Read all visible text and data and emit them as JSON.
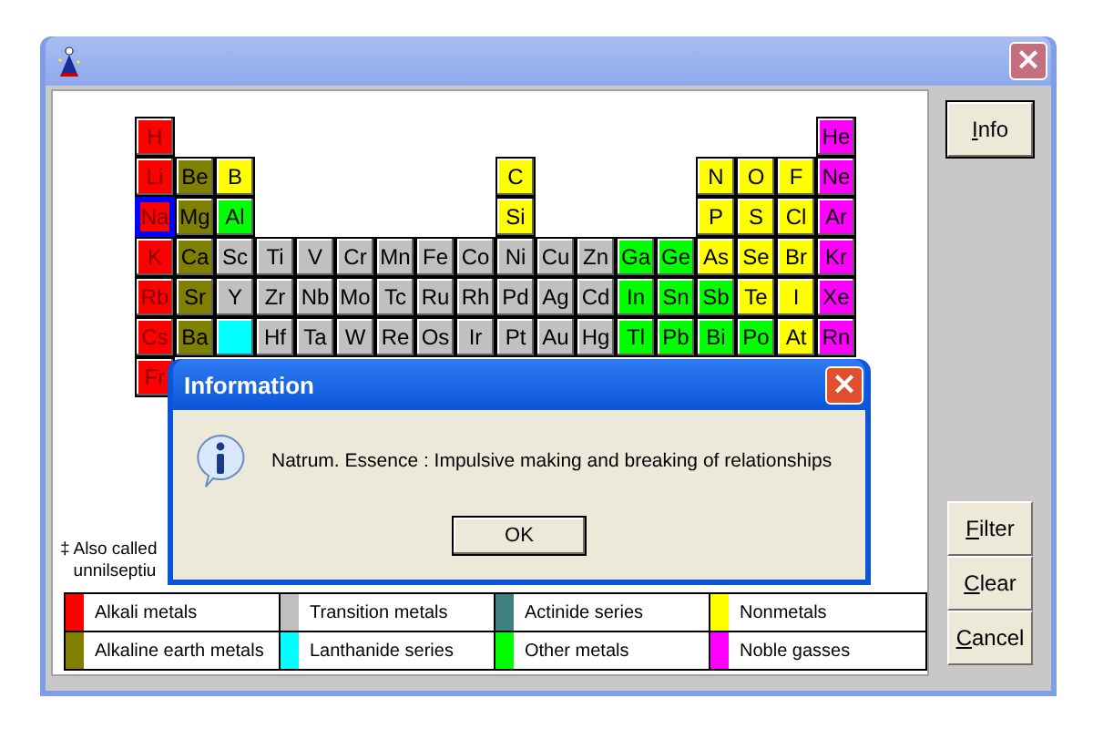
{
  "window": {
    "close": "×"
  },
  "table": {
    "rows": [
      {
        "cells": [
          {
            "symbol": "H",
            "kind": "alkali",
            "selected": false
          },
          {
            "kind": "empty"
          },
          {
            "kind": "empty"
          },
          {
            "kind": "empty"
          },
          {
            "kind": "empty"
          },
          {
            "kind": "empty"
          },
          {
            "kind": "empty"
          },
          {
            "kind": "empty"
          },
          {
            "kind": "empty"
          },
          {
            "kind": "empty"
          },
          {
            "kind": "empty"
          },
          {
            "kind": "empty"
          },
          {
            "kind": "empty"
          },
          {
            "kind": "empty"
          },
          {
            "kind": "empty"
          },
          {
            "kind": "empty"
          },
          {
            "kind": "empty"
          },
          {
            "symbol": "He",
            "kind": "noble",
            "selected": false
          }
        ]
      },
      {
        "cells": [
          {
            "symbol": "Li",
            "kind": "alkali",
            "selected": false
          },
          {
            "symbol": "Be",
            "kind": "alkaline",
            "selected": false
          },
          {
            "symbol": "B",
            "kind": "nonmetal",
            "selected": false
          },
          {
            "kind": "empty"
          },
          {
            "kind": "empty"
          },
          {
            "kind": "empty"
          },
          {
            "kind": "empty"
          },
          {
            "kind": "empty"
          },
          {
            "kind": "empty"
          },
          {
            "symbol": "C",
            "kind": "nonmetal",
            "selected": false
          },
          {
            "kind": "empty"
          },
          {
            "kind": "empty"
          },
          {
            "kind": "empty"
          },
          {
            "kind": "empty"
          },
          {
            "symbol": "N",
            "kind": "nonmetal",
            "selected": false
          },
          {
            "symbol": "O",
            "kind": "nonmetal",
            "selected": false
          },
          {
            "symbol": "F",
            "kind": "nonmetal",
            "selected": false
          },
          {
            "symbol": "Ne",
            "kind": "noble",
            "selected": false
          }
        ]
      },
      {
        "cells": [
          {
            "symbol": "Na",
            "kind": "alkali",
            "selected": true
          },
          {
            "symbol": "Mg",
            "kind": "alkaline",
            "selected": false
          },
          {
            "symbol": "Al",
            "kind": "other",
            "selected": false
          },
          {
            "kind": "empty"
          },
          {
            "kind": "empty"
          },
          {
            "kind": "empty"
          },
          {
            "kind": "empty"
          },
          {
            "kind": "empty"
          },
          {
            "kind": "empty"
          },
          {
            "symbol": "Si",
            "kind": "nonmetal",
            "selected": false
          },
          {
            "kind": "empty"
          },
          {
            "kind": "empty"
          },
          {
            "kind": "empty"
          },
          {
            "kind": "empty"
          },
          {
            "symbol": "P",
            "kind": "nonmetal",
            "selected": false
          },
          {
            "symbol": "S",
            "kind": "nonmetal",
            "selected": false
          },
          {
            "symbol": "Cl",
            "kind": "nonmetal",
            "selected": false
          },
          {
            "symbol": "Ar",
            "kind": "noble",
            "selected": false
          }
        ]
      },
      {
        "cells": [
          {
            "symbol": "K",
            "kind": "alkali",
            "selected": false
          },
          {
            "symbol": "Ca",
            "kind": "alkaline",
            "selected": false
          },
          {
            "symbol": "Sc",
            "kind": "transition",
            "selected": false
          },
          {
            "symbol": "Ti",
            "kind": "transition",
            "selected": false
          },
          {
            "symbol": "V",
            "kind": "transition",
            "selected": false
          },
          {
            "symbol": "Cr",
            "kind": "transition",
            "selected": false
          },
          {
            "symbol": "Mn",
            "kind": "transition",
            "selected": false
          },
          {
            "symbol": "Fe",
            "kind": "transition",
            "selected": false
          },
          {
            "symbol": "Co",
            "kind": "transition",
            "selected": false
          },
          {
            "symbol": "Ni",
            "kind": "transition",
            "selected": false
          },
          {
            "symbol": "Cu",
            "kind": "transition",
            "selected": false
          },
          {
            "symbol": "Zn",
            "kind": "transition",
            "selected": false
          },
          {
            "symbol": "Ga",
            "kind": "other",
            "selected": false
          },
          {
            "symbol": "Ge",
            "kind": "other",
            "selected": false
          },
          {
            "symbol": "As",
            "kind": "nonmetal",
            "selected": false
          },
          {
            "symbol": "Se",
            "kind": "nonmetal",
            "selected": false
          },
          {
            "symbol": "Br",
            "kind": "nonmetal",
            "selected": false
          },
          {
            "symbol": "Kr",
            "kind": "noble",
            "selected": false
          }
        ]
      },
      {
        "cells": [
          {
            "symbol": "Rb",
            "kind": "alkali",
            "selected": false
          },
          {
            "symbol": "Sr",
            "kind": "alkaline",
            "selected": false
          },
          {
            "symbol": "Y",
            "kind": "transition",
            "selected": false
          },
          {
            "symbol": "Zr",
            "kind": "transition",
            "selected": false
          },
          {
            "symbol": "Nb",
            "kind": "transition",
            "selected": false
          },
          {
            "symbol": "Mo",
            "kind": "transition",
            "selected": false
          },
          {
            "symbol": "Tc",
            "kind": "transition",
            "selected": false
          },
          {
            "symbol": "Ru",
            "kind": "transition",
            "selected": false
          },
          {
            "symbol": "Rh",
            "kind": "transition",
            "selected": false
          },
          {
            "symbol": "Pd",
            "kind": "transition",
            "selected": false
          },
          {
            "symbol": "Ag",
            "kind": "transition",
            "selected": false
          },
          {
            "symbol": "Cd",
            "kind": "transition",
            "selected": false
          },
          {
            "symbol": "In",
            "kind": "other",
            "selected": false
          },
          {
            "symbol": "Sn",
            "kind": "other",
            "selected": false
          },
          {
            "symbol": "Sb",
            "kind": "other",
            "selected": false
          },
          {
            "symbol": "Te",
            "kind": "nonmetal",
            "selected": false
          },
          {
            "symbol": "I",
            "kind": "nonmetal",
            "selected": false
          },
          {
            "symbol": "Xe",
            "kind": "noble",
            "selected": false
          }
        ]
      },
      {
        "cells": [
          {
            "symbol": "Cs",
            "kind": "alkali",
            "selected": false
          },
          {
            "symbol": "Ba",
            "kind": "alkaline",
            "selected": false
          },
          {
            "kind": "lanthanide",
            "selected": false
          },
          {
            "symbol": "Hf",
            "kind": "transition",
            "selected": false
          },
          {
            "symbol": "Ta",
            "kind": "transition",
            "selected": false
          },
          {
            "symbol": "W",
            "kind": "transition",
            "selected": false
          },
          {
            "symbol": "Re",
            "kind": "transition",
            "selected": false
          },
          {
            "symbol": "Os",
            "kind": "transition",
            "selected": false
          },
          {
            "symbol": "Ir",
            "kind": "transition",
            "selected": false
          },
          {
            "symbol": "Pt",
            "kind": "transition",
            "selected": false
          },
          {
            "symbol": "Au",
            "kind": "transition",
            "selected": false
          },
          {
            "symbol": "Hg",
            "kind": "transition",
            "selected": false
          },
          {
            "symbol": "Tl",
            "kind": "other",
            "selected": false
          },
          {
            "symbol": "Pb",
            "kind": "other",
            "selected": false
          },
          {
            "symbol": "Bi",
            "kind": "other",
            "selected": false
          },
          {
            "symbol": "Po",
            "kind": "other",
            "selected": false
          },
          {
            "symbol": "At",
            "kind": "nonmetal",
            "selected": false
          },
          {
            "symbol": "Rn",
            "kind": "noble",
            "selected": false
          }
        ]
      },
      {
        "cells": [
          {
            "symbol": "Fr",
            "kind": "alkali",
            "selected": false
          }
        ]
      }
    ]
  },
  "footnote": {
    "mark": "‡",
    "lines": [
      "Also called",
      "unnilseptiu"
    ]
  },
  "legend": [
    {
      "label": "Alkali metals",
      "kind": "alkali"
    },
    {
      "label": "Transition metals",
      "kind": "transition"
    },
    {
      "label": "Actinide series",
      "kind": "actinide"
    },
    {
      "label": "Nonmetals",
      "kind": "nonmetal"
    },
    {
      "label": "Alkaline earth metals",
      "kind": "alkaline"
    },
    {
      "label": "Lanthanide series",
      "kind": "lanthanide"
    },
    {
      "label": "Other metals",
      "kind": "other"
    },
    {
      "label": "Noble gasses",
      "kind": "noble"
    }
  ],
  "buttons": {
    "top": [
      "Info"
    ],
    "bottom": [
      "Filter",
      "Clear",
      "Cancel"
    ]
  },
  "dialog": {
    "title": "Information",
    "close": "×",
    "message": "Natrum. Essence : Impulsive making and breaking of relationships",
    "button": "OK"
  }
}
